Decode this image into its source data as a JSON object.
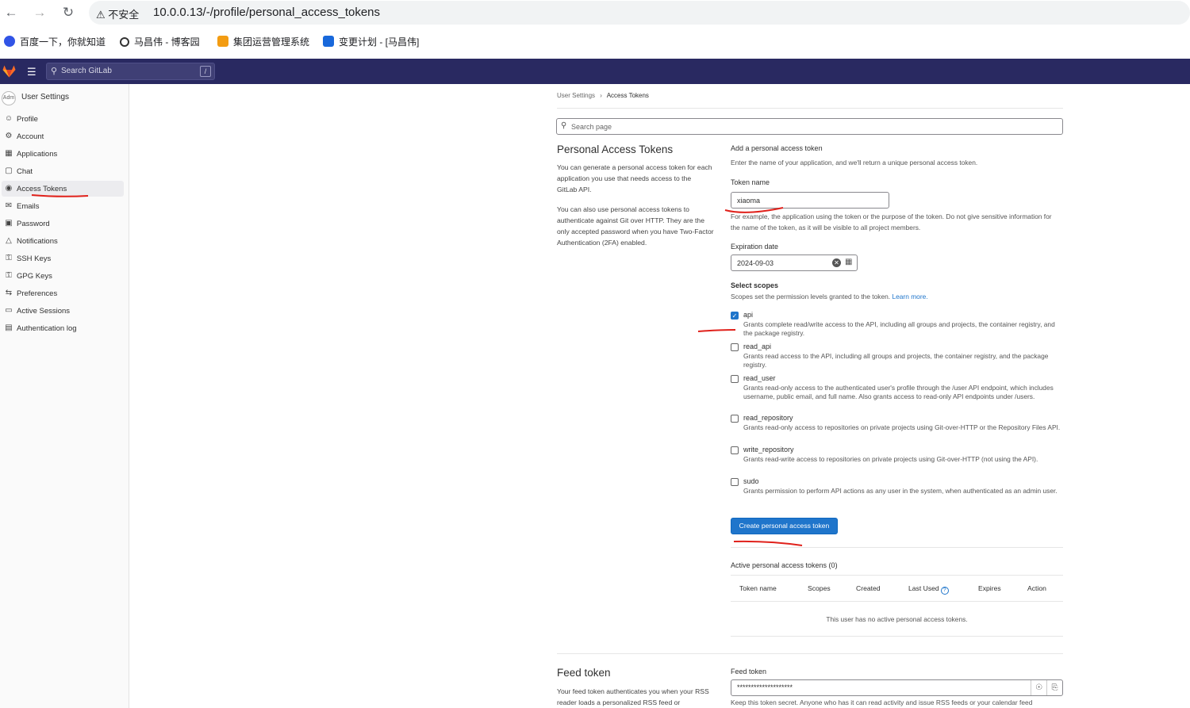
{
  "browser": {
    "warning": "不安全",
    "url": "10.0.0.13/-/profile/personal_access_tokens",
    "bookmarks": [
      "百度一下，你就知道",
      "马昌伟 - 博客园",
      "集团运营管理系统",
      "变更计划 - [马昌伟]"
    ]
  },
  "header": {
    "search_placeholder": "Search GitLab",
    "search_shortcut": "/"
  },
  "sidebar": {
    "avatar_text": "Adm",
    "context_title": "User Settings",
    "items": [
      {
        "label": "Profile",
        "icon": "profile-icon"
      },
      {
        "label": "Account",
        "icon": "account-icon"
      },
      {
        "label": "Applications",
        "icon": "applications-icon"
      },
      {
        "label": "Chat",
        "icon": "chat-icon"
      },
      {
        "label": "Access Tokens",
        "icon": "token-icon",
        "active": true
      },
      {
        "label": "Emails",
        "icon": "mail-icon"
      },
      {
        "label": "Password",
        "icon": "lock-icon"
      },
      {
        "label": "Notifications",
        "icon": "bell-icon"
      },
      {
        "label": "SSH Keys",
        "icon": "key-icon"
      },
      {
        "label": "GPG Keys",
        "icon": "key-icon"
      },
      {
        "label": "Preferences",
        "icon": "preferences-icon"
      },
      {
        "label": "Active Sessions",
        "icon": "monitor-icon"
      },
      {
        "label": "Authentication log",
        "icon": "log-icon"
      }
    ]
  },
  "breadcrumb": {
    "parent": "User Settings",
    "separator": "›",
    "current": "Access Tokens"
  },
  "page_search": {
    "placeholder": "Search page"
  },
  "pat": {
    "title": "Personal Access Tokens",
    "desc1": "You can generate a personal access token for each application you use that needs access to the GitLab API.",
    "desc2": "You can also use personal access tokens to authenticate against Git over HTTP. They are the only accepted password when you have Two-Factor Authentication (2FA) enabled.",
    "form_title": "Add a personal access token",
    "form_desc": "Enter the name of your application, and we'll return a unique personal access token.",
    "token_name_label": "Token name",
    "token_name_value": "xiaoma",
    "token_name_help": "For example, the application using the token or the purpose of the token. Do not give sensitive information for the name of the token, as it will be visible to all project members.",
    "expiration_label": "Expiration date",
    "expiration_value": "2024-09-03",
    "scopes_label": "Select scopes",
    "scopes_help": "Scopes set the permission levels granted to the token.",
    "learn_more": "Learn more.",
    "scopes": [
      {
        "name": "api",
        "checked": true,
        "desc": "Grants complete read/write access to the API, including all groups and projects, the container registry, and the package registry."
      },
      {
        "name": "read_api",
        "checked": false,
        "desc": "Grants read access to the API, including all groups and projects, the container registry, and the package registry."
      },
      {
        "name": "read_user",
        "checked": false,
        "desc": "Grants read-only access to the authenticated user's profile through the /user API endpoint, which includes username, public email, and full name. Also grants access to read-only API endpoints under /users."
      },
      {
        "name": "read_repository",
        "checked": false,
        "desc": "Grants read-only access to repositories on private projects using Git-over-HTTP or the Repository Files API."
      },
      {
        "name": "write_repository",
        "checked": false,
        "desc": "Grants read-write access to repositories on private projects using Git-over-HTTP (not using the API)."
      },
      {
        "name": "sudo",
        "checked": false,
        "desc": "Grants permission to perform API actions as any user in the system, when authenticated as an admin user."
      }
    ],
    "create_button": "Create personal access token",
    "active_title": "Active personal access tokens (0)",
    "table_headers": [
      "Token name",
      "Scopes",
      "Created",
      "Last Used",
      "Expires",
      "Action"
    ],
    "empty_text": "This user has no active personal access tokens."
  },
  "feed": {
    "title": "Feed token",
    "desc": "Your feed token authenticates you when your RSS reader loads a personalized RSS feed or",
    "label": "Feed token",
    "value": "********************",
    "help": "Keep this token secret. Anyone who has it can read activity and issue RSS feeds or your calendar feed"
  },
  "colors": {
    "header_bg": "#292961",
    "primary": "#1f75cb",
    "annotation": "#e0211b"
  }
}
